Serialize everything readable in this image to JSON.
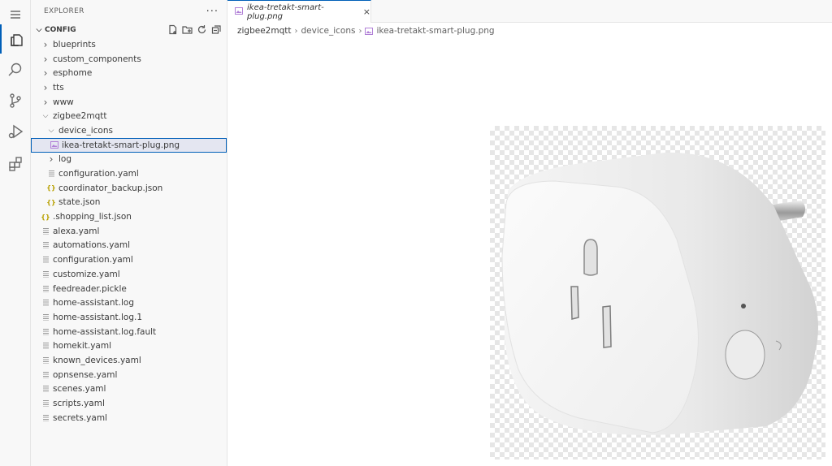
{
  "explorer": {
    "title": "EXPLORER",
    "more": "···",
    "section": "CONFIG",
    "tree": [
      {
        "label": "blueprints",
        "type": "folder",
        "depth": 1,
        "expanded": false
      },
      {
        "label": "custom_components",
        "type": "folder",
        "depth": 1,
        "expanded": false
      },
      {
        "label": "esphome",
        "type": "folder",
        "depth": 1,
        "expanded": false
      },
      {
        "label": "tts",
        "type": "folder",
        "depth": 1,
        "expanded": false
      },
      {
        "label": "www",
        "type": "folder",
        "depth": 1,
        "expanded": false
      },
      {
        "label": "zigbee2mqtt",
        "type": "folder",
        "depth": 1,
        "expanded": true
      },
      {
        "label": "device_icons",
        "type": "folder",
        "depth": 2,
        "expanded": true
      },
      {
        "label": "ikea-tretakt-smart-plug.png",
        "type": "image",
        "depth": 3,
        "selected": true
      },
      {
        "label": "log",
        "type": "folder",
        "depth": 2,
        "expanded": false
      },
      {
        "label": "configuration.yaml",
        "type": "yaml",
        "depth": 2
      },
      {
        "label": "coordinator_backup.json",
        "type": "json",
        "depth": 2
      },
      {
        "label": "state.json",
        "type": "json",
        "depth": 2
      },
      {
        "label": ".shopping_list.json",
        "type": "json",
        "depth": 1
      },
      {
        "label": "alexa.yaml",
        "type": "yaml",
        "depth": 1
      },
      {
        "label": "automations.yaml",
        "type": "yaml",
        "depth": 1
      },
      {
        "label": "configuration.yaml",
        "type": "yaml",
        "depth": 1
      },
      {
        "label": "customize.yaml",
        "type": "yaml",
        "depth": 1
      },
      {
        "label": "feedreader.pickle",
        "type": "yaml",
        "depth": 1
      },
      {
        "label": "home-assistant.log",
        "type": "yaml",
        "depth": 1
      },
      {
        "label": "home-assistant.log.1",
        "type": "yaml",
        "depth": 1
      },
      {
        "label": "home-assistant.log.fault",
        "type": "yaml",
        "depth": 1
      },
      {
        "label": "homekit.yaml",
        "type": "yaml",
        "depth": 1
      },
      {
        "label": "known_devices.yaml",
        "type": "yaml",
        "depth": 1
      },
      {
        "label": "opnsense.yaml",
        "type": "yaml",
        "depth": 1
      },
      {
        "label": "scenes.yaml",
        "type": "yaml",
        "depth": 1
      },
      {
        "label": "scripts.yaml",
        "type": "yaml",
        "depth": 1
      },
      {
        "label": "secrets.yaml",
        "type": "yaml",
        "depth": 1
      }
    ]
  },
  "tab": {
    "label": "ikea-tretakt-smart-plug.png",
    "close": "×"
  },
  "breadcrumb": [
    "zigbee2mqtt",
    "device_icons",
    "ikea-tretakt-smart-plug.png"
  ],
  "colors": {
    "accent": "#005fb8",
    "json_icon": "#b8a000",
    "image_icon": "#b180d7"
  }
}
